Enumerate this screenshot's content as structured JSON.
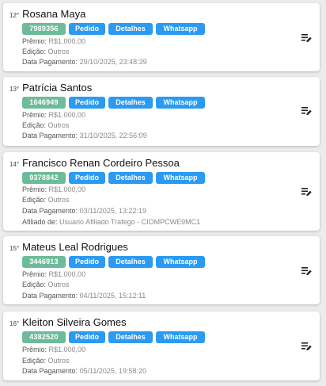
{
  "list": {
    "cards": [
      {
        "rank": "12°",
        "name": "Rosana Maya",
        "id": "7989356",
        "buttons": {
          "pedido": "Pedido",
          "detalhes": "Detalhes",
          "whatsapp": "Whatsapp"
        },
        "lines": [
          {
            "label": "Prêmio:",
            "value": "R$1.000,00"
          },
          {
            "label": "Edição:",
            "value": "Outros"
          },
          {
            "label": "Data Pagamento:",
            "value": "29/10/2025, 23:48:39"
          }
        ],
        "icon": "edit-note-icon"
      },
      {
        "rank": "13°",
        "name": "Patrícia Santos",
        "id": "1646949",
        "buttons": {
          "pedido": "Pedido",
          "detalhes": "Detalhes",
          "whatsapp": "Whatsapp"
        },
        "lines": [
          {
            "label": "Prêmio:",
            "value": "R$1.000,00"
          },
          {
            "label": "Edição:",
            "value": "Outros"
          },
          {
            "label": "Data Pagamento:",
            "value": "31/10/2025, 22:56:09"
          }
        ],
        "icon": "edit-note-icon"
      },
      {
        "rank": "14°",
        "name": "Francisco Renan Cordeiro Pessoa",
        "id": "9378842",
        "buttons": {
          "pedido": "Pedido",
          "detalhes": "Detalhes",
          "whatsapp": "Whatsapp"
        },
        "lines": [
          {
            "label": "Prêmio:",
            "value": "R$1.000,00"
          },
          {
            "label": "Edição:",
            "value": "Outros"
          },
          {
            "label": "Data Pagamento:",
            "value": "03/11/2025, 13:22:19"
          },
          {
            "label": "Afiliado de:",
            "value": "Usuario Afiliado Trafego - CIOMPCWE9MC1"
          }
        ],
        "icon": "edit-note-icon"
      },
      {
        "rank": "15°",
        "name": "Mateus Leal Rodrigues",
        "id": "3446913",
        "buttons": {
          "pedido": "Pedido",
          "detalhes": "Detalhes",
          "whatsapp": "Whatsapp"
        },
        "lines": [
          {
            "label": "Prêmio:",
            "value": "R$1.000,00"
          },
          {
            "label": "Edição:",
            "value": "Outros"
          },
          {
            "label": "Data Pagamento:",
            "value": "04/11/2025, 15:12:11"
          }
        ],
        "icon": "edit-note-icon"
      },
      {
        "rank": "16°",
        "name": "Kleiton Silveira Gomes",
        "id": "4382520",
        "buttons": {
          "pedido": "Pedido",
          "detalhes": "Detalhes",
          "whatsapp": "Whatsapp"
        },
        "lines": [
          {
            "label": "Prêmio:",
            "value": "R$1.000,00"
          },
          {
            "label": "Edição:",
            "value": "Outros"
          },
          {
            "label": "Data Pagamento:",
            "value": "05/11/2025, 19:58:20"
          }
        ],
        "icon": "edit-note-icon"
      }
    ]
  },
  "colors": {
    "id_badge": "#6dbb9a",
    "action_button": "#2b9af3",
    "background": "#ececec",
    "card": "#ffffff"
  }
}
